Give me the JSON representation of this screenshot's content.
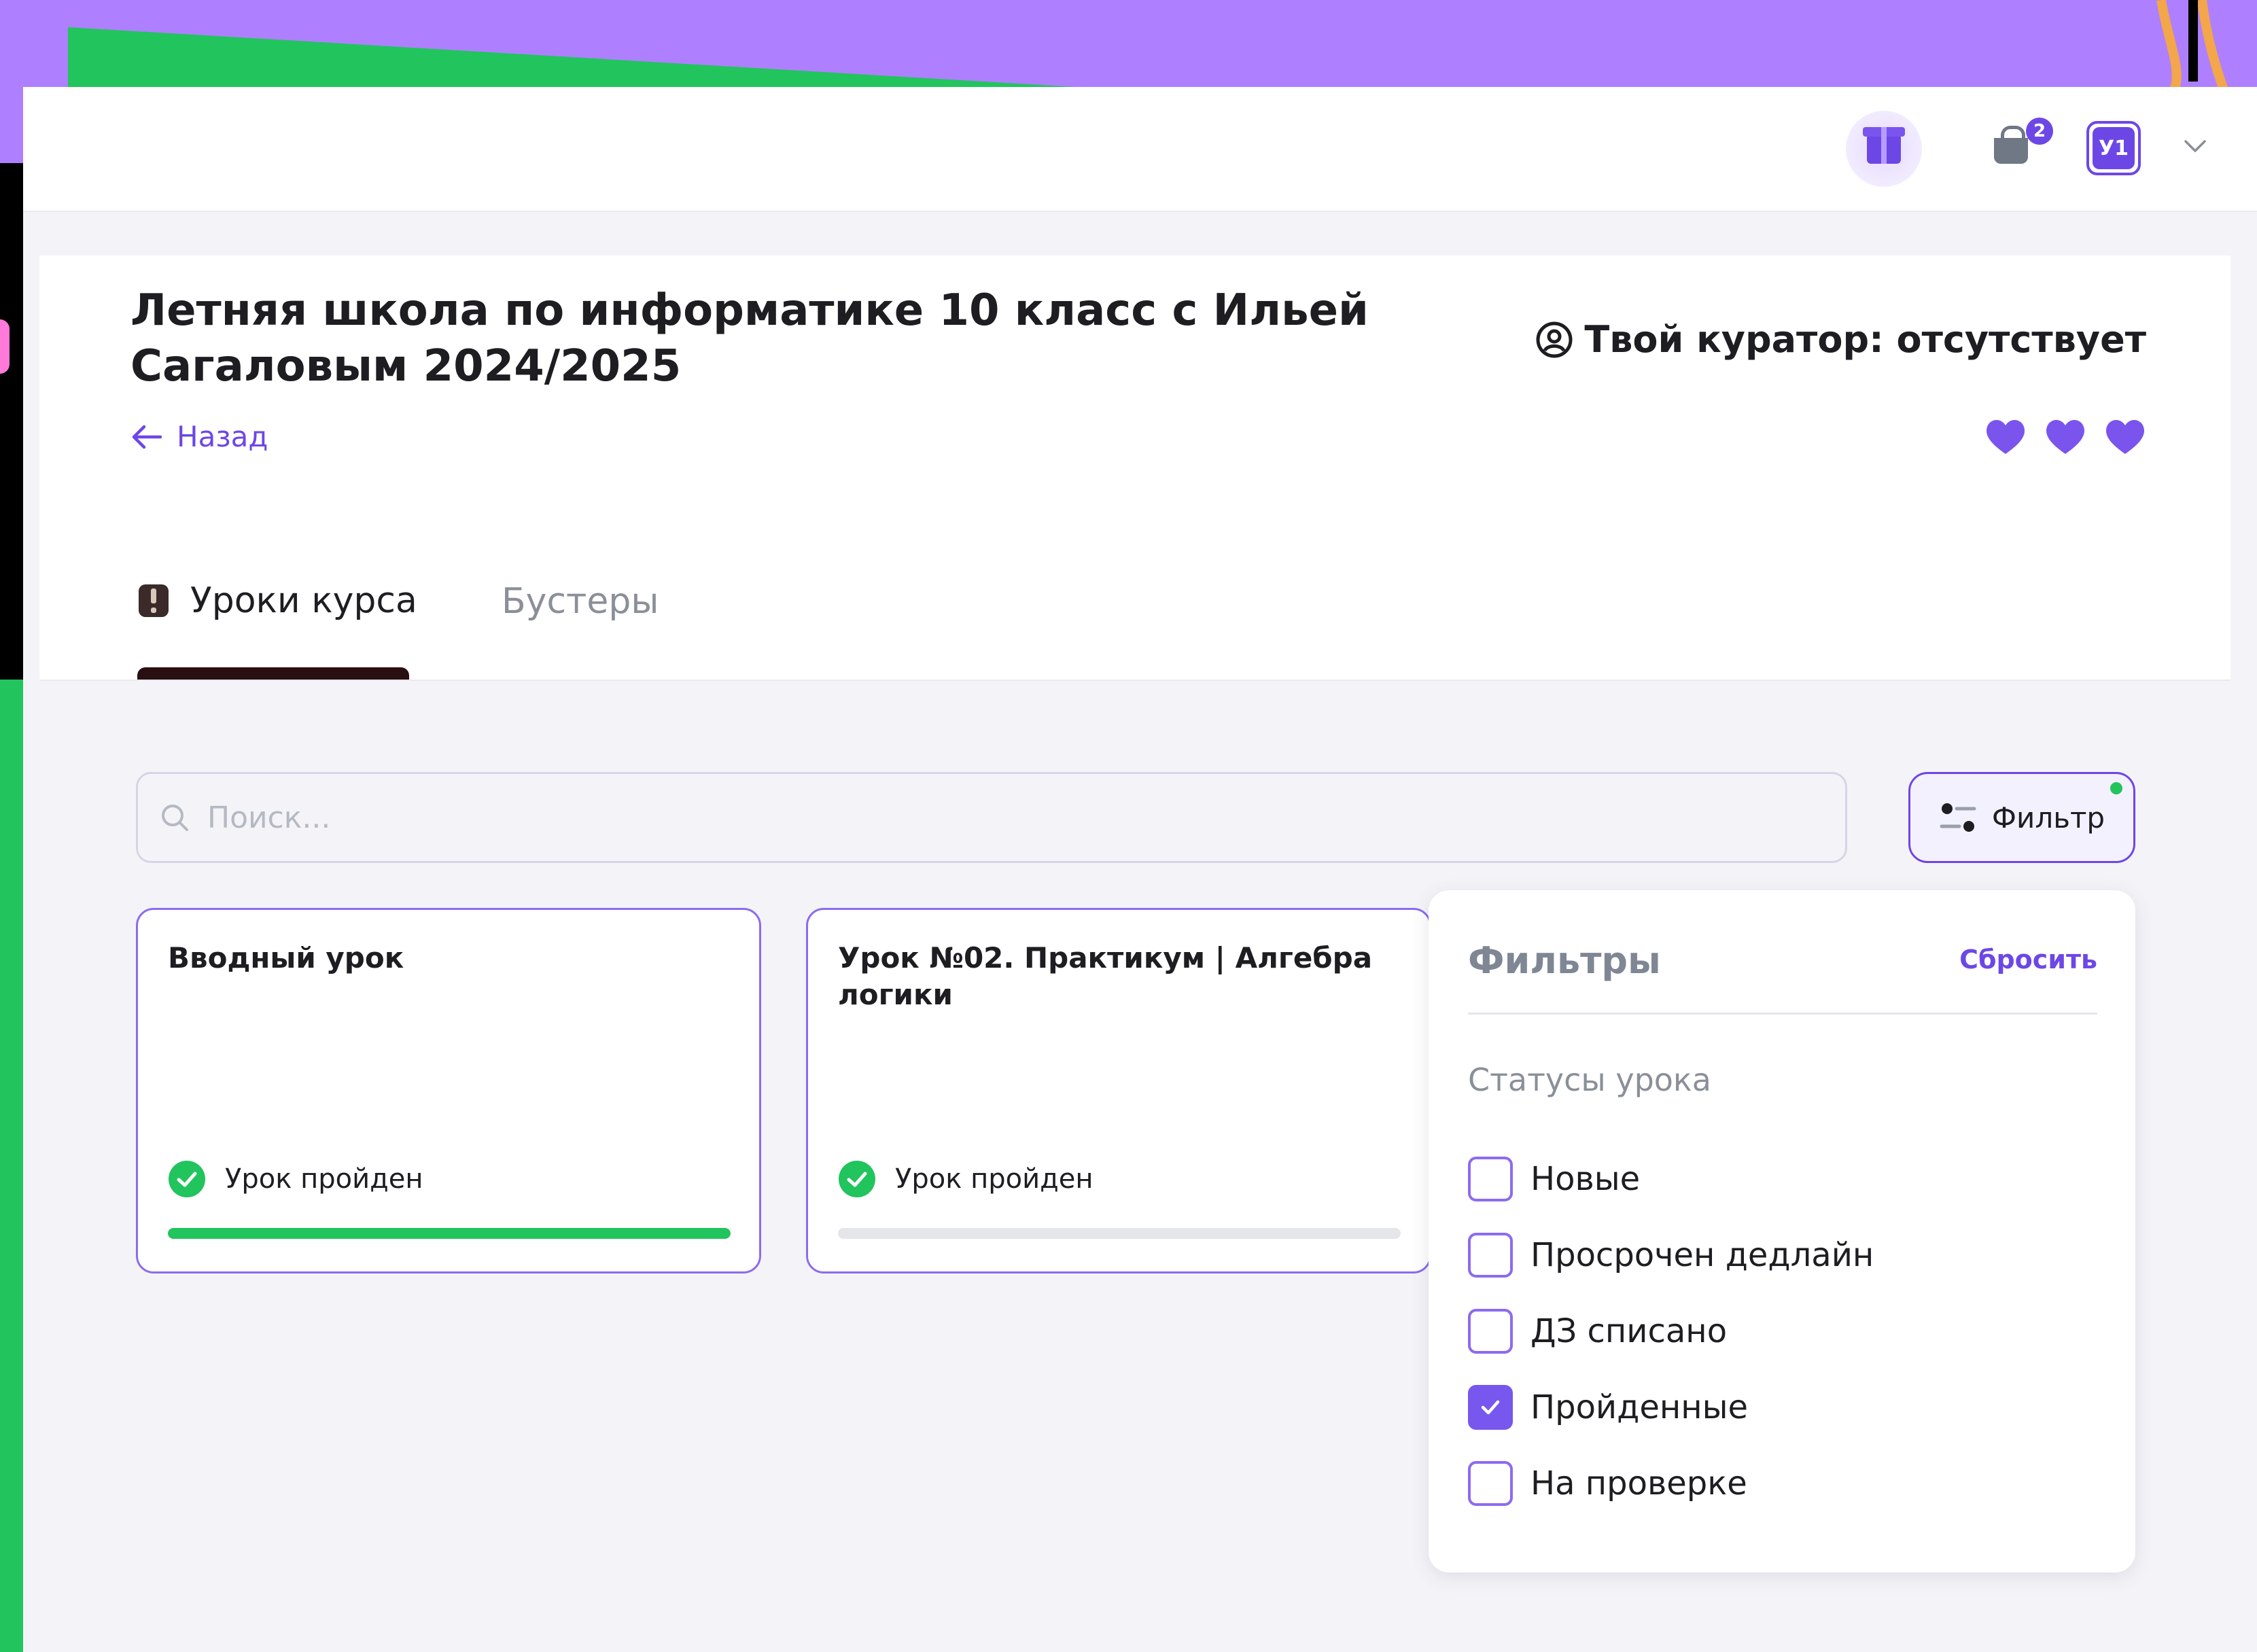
{
  "header": {
    "notifications_count": "2",
    "user_initials": "У1"
  },
  "course": {
    "title": "Летняя школа по информатике 10 класс с Ильей Сагаловым 2024/2025",
    "back_label": "Назад",
    "curator_text": "Твой куратор: отсутствует",
    "hearts_count": 3,
    "heart_color": "#7b54ee"
  },
  "tabs": [
    {
      "label": "Уроки курса",
      "active": true
    },
    {
      "label": "Бустеры",
      "active": false
    }
  ],
  "search": {
    "placeholder": "Поиск..."
  },
  "filter_button": {
    "label": "Фильтр",
    "active_indicator_color": "#22c45d"
  },
  "lessons": [
    {
      "title": "Вводный урок",
      "status": "Урок пройден",
      "progress": 1.0
    },
    {
      "title": "Урок №02. Практикум | Алгебра логики",
      "status": "Урок пройден",
      "progress": 0.0
    }
  ],
  "filters_panel": {
    "title": "Фильтры",
    "reset_label": "Сбросить",
    "section_label": "Статусы урока",
    "options": [
      {
        "label": "Новые",
        "checked": false
      },
      {
        "label": "Просрочен дедлайн",
        "checked": false
      },
      {
        "label": "ДЗ списано",
        "checked": false
      },
      {
        "label": "Пройденные",
        "checked": true
      },
      {
        "label": "На проверке",
        "checked": false
      }
    ]
  },
  "colors": {
    "accent": "#6d47e6",
    "success": "#22c45d",
    "background_purple": "#ae80ff"
  }
}
